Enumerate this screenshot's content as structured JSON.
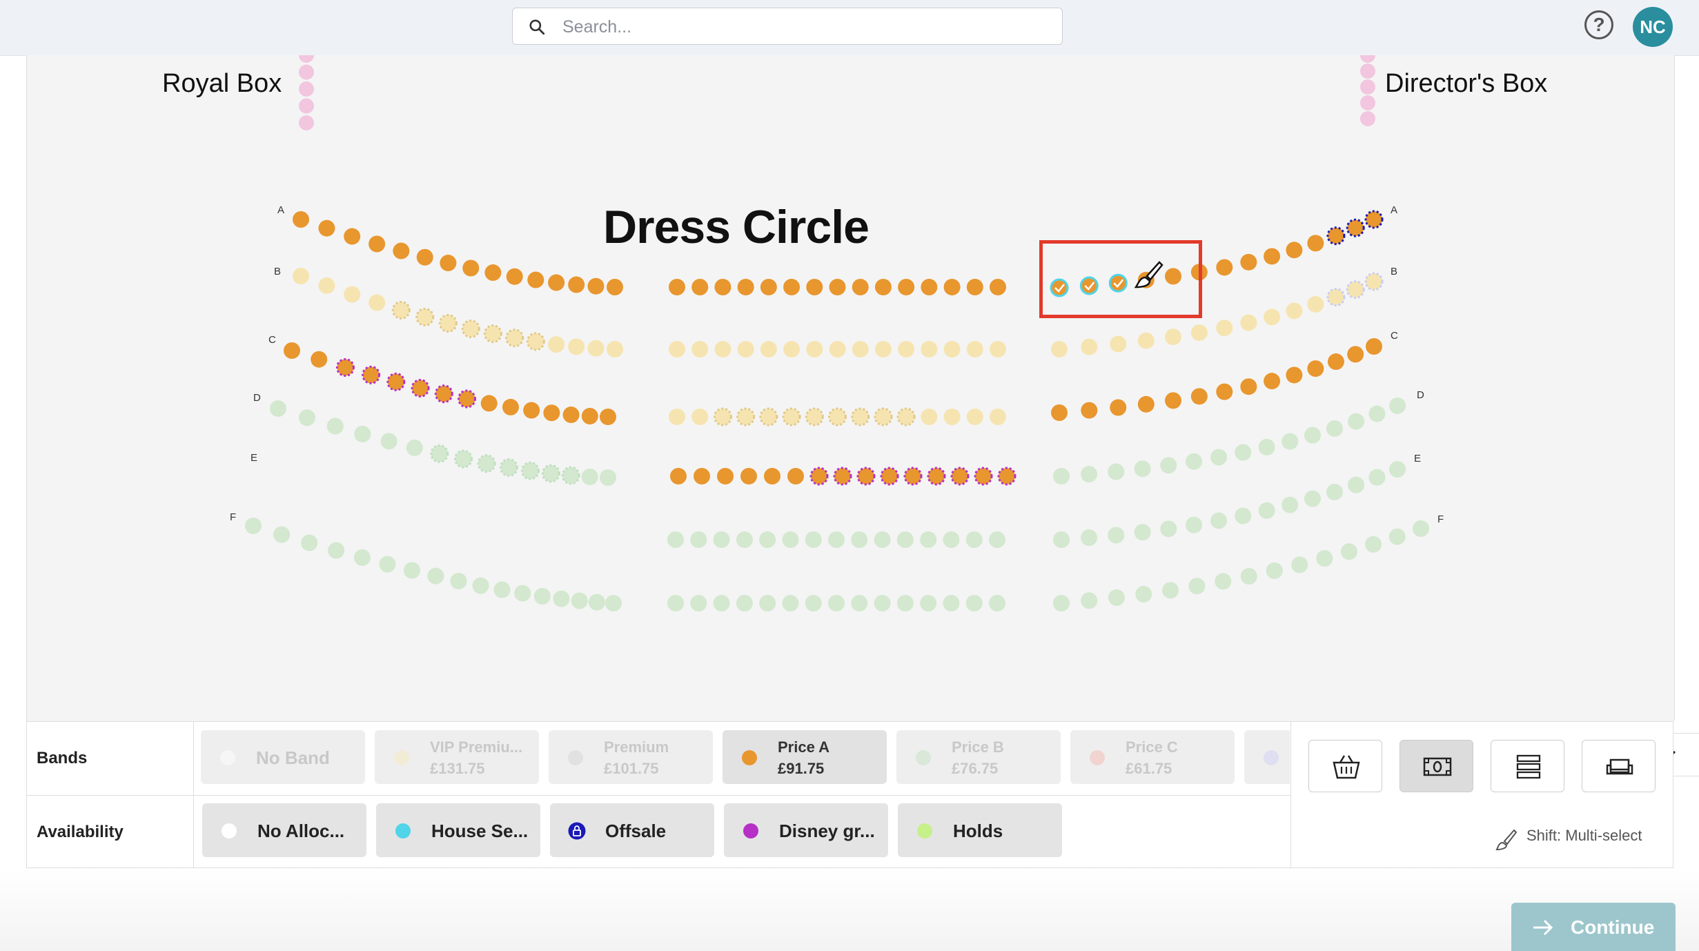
{
  "search": {
    "placeholder": "Search..."
  },
  "header": {
    "help_label": "?",
    "avatar_initials": "NC"
  },
  "venue": {
    "royal_box": "Royal Box",
    "directors_box": "Director's Box",
    "section_title": "Dress Circle",
    "row_letters": [
      "A",
      "B",
      "C",
      "D",
      "E",
      "F"
    ]
  },
  "bands": {
    "label": "Bands",
    "items": [
      {
        "name": "No Band",
        "price": "",
        "color": "#ffffff",
        "state": "faded"
      },
      {
        "name": "VIP Premiu...",
        "price": "£131.75",
        "color": "#f7e8b6",
        "state": "faded"
      },
      {
        "name": "Premium",
        "price": "£101.75",
        "color": "#d0d0d0",
        "state": "faded"
      },
      {
        "name": "Price A",
        "price": "£91.75",
        "color": "#e8962e",
        "state": "active"
      },
      {
        "name": "Price B",
        "price": "£76.75",
        "color": "#bfe0bf",
        "state": "faded"
      },
      {
        "name": "Price C",
        "price": "£61.75",
        "color": "#f5b3a8",
        "state": "faded"
      },
      {
        "name": "",
        "price": "",
        "color": "#c9ccf5",
        "state": "faded"
      }
    ]
  },
  "availability": {
    "label": "Availability",
    "items": [
      {
        "name": "No Alloc...",
        "color": "#ffffff"
      },
      {
        "name": "House Se...",
        "color": "#4fd4e8"
      },
      {
        "name": "Offsale",
        "color": "#1a1ab8"
      },
      {
        "name": "Disney gr...",
        "color": "#b62fc6"
      },
      {
        "name": "Holds",
        "color": "#c6f08a"
      }
    ]
  },
  "tools": {
    "items": [
      "basket-icon",
      "money-icon",
      "list-icon",
      "seat-icon"
    ],
    "selected": "money-icon",
    "shift_hint": "Shift: Multi-select"
  },
  "footer": {
    "continue_label": "Continue"
  }
}
